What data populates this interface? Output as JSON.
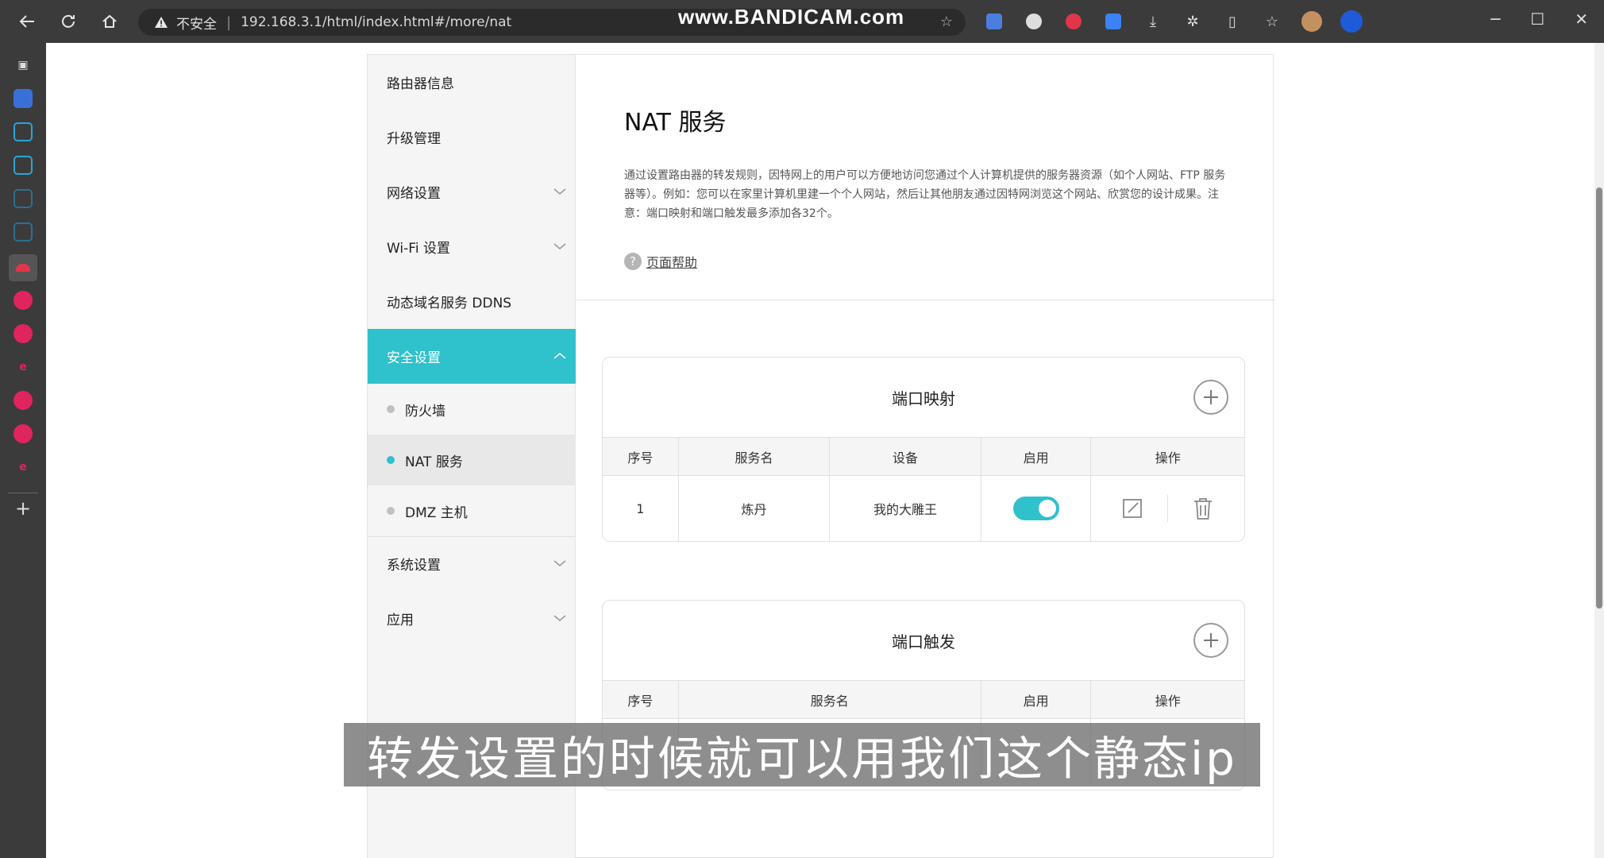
{
  "browser": {
    "insecure_label": "不安全",
    "url": "192.168.3.1/html/index.html#/more/nat",
    "watermark": "www.BANDICAM.com"
  },
  "menu": {
    "items": [
      {
        "label": "路由器信息"
      },
      {
        "label": "升级管理"
      },
      {
        "label": "网络设置"
      },
      {
        "label": "Wi-Fi 设置"
      },
      {
        "label": "动态域名服务 DDNS"
      },
      {
        "label": "安全设置"
      }
    ],
    "sub_items": [
      {
        "label": "防火墙"
      },
      {
        "label": "NAT 服务"
      },
      {
        "label": "DMZ 主机"
      }
    ],
    "bottom_items": [
      {
        "label": "系统设置"
      },
      {
        "label": "应用"
      }
    ]
  },
  "content": {
    "title": "NAT 服务",
    "description": "通过设置路由器的转发规则，因特网上的用户可以方便地访问您通过个人计算机提供的服务器资源（如个人网站、FTP 服务器等）。例如：您可以在家里计算机里建一个个人网站，然后让其他朋友通过因特网浏览这个网站、欣赏您的设计成果。注意：端口映射和端口触发最多添加各32个。",
    "help_link": "页面帮助"
  },
  "port_mapping": {
    "title": "端口映射",
    "headers": [
      "序号",
      "服务名",
      "设备",
      "启用",
      "操作"
    ],
    "rows": [
      {
        "index": "1",
        "service": "炼丹",
        "device": "我的大雕王",
        "enabled": true
      }
    ]
  },
  "port_trigger": {
    "title": "端口触发",
    "headers": [
      "序号",
      "服务名",
      "启用",
      "操作"
    ]
  },
  "subtitle": "转发设置的时候就可以用我们这个静态ip",
  "colors": {
    "accent": "#2fc1cc",
    "chrome_dark": "#3b3b3b"
  }
}
